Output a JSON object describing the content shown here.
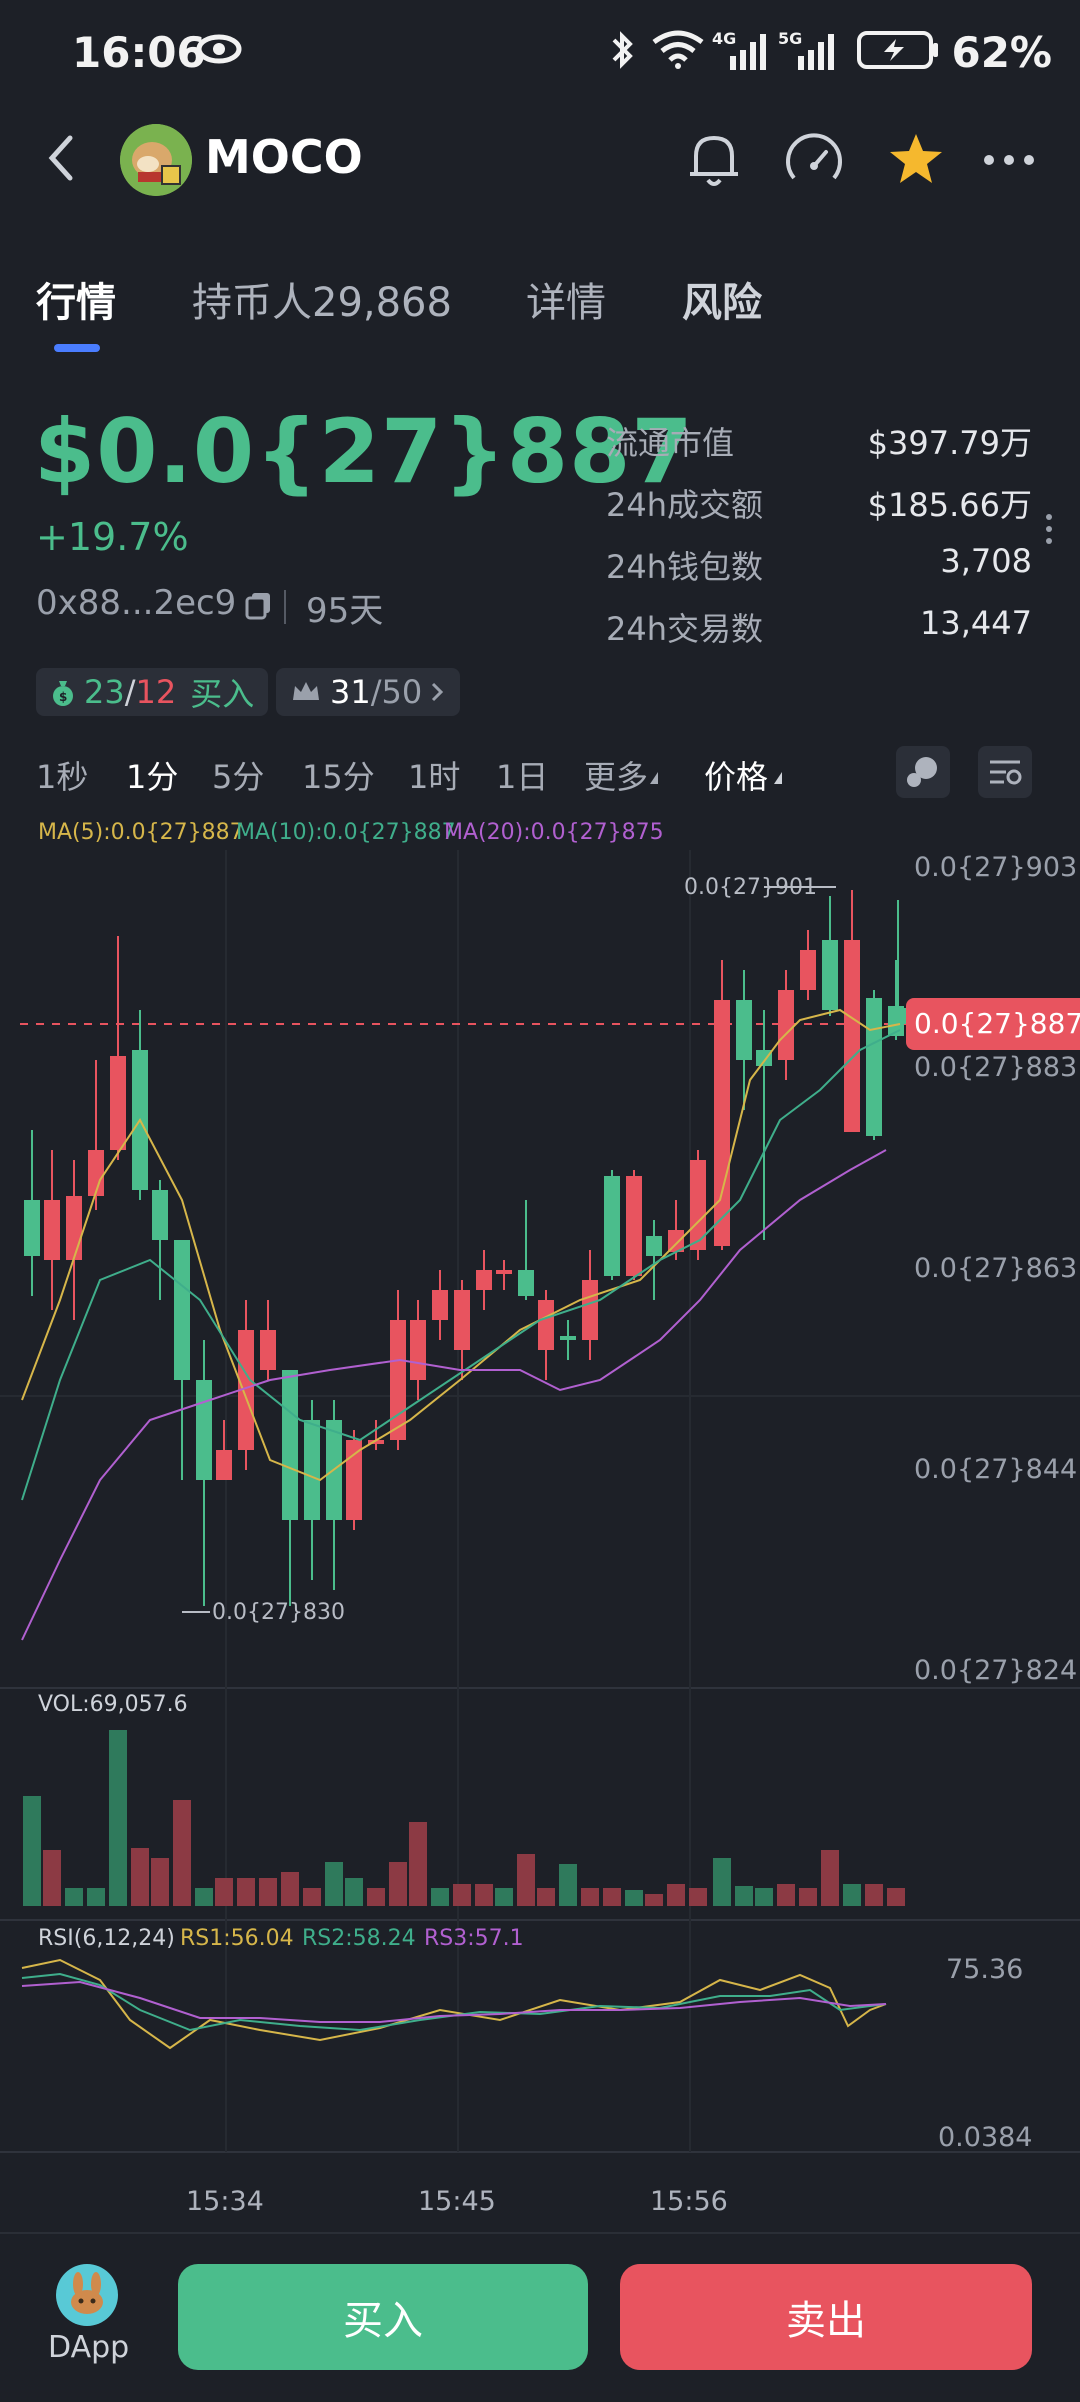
{
  "status": {
    "time": "16:06",
    "battery": "62%"
  },
  "header": {
    "title": "MOCO"
  },
  "tabs": [
    {
      "label": "行情"
    },
    {
      "label": "持币人29,868"
    },
    {
      "label": "详情"
    },
    {
      "label": "风险"
    }
  ],
  "price": {
    "value": "$0.0{27}887",
    "change": "+19.7%",
    "address": "0x88...2ec9",
    "age": "95天"
  },
  "stats": [
    {
      "label": "流通市值",
      "value": "$397.79万"
    },
    {
      "label": "24h成交额",
      "value": "$185.66万"
    },
    {
      "label": "24h钱包数",
      "value": "3,708"
    },
    {
      "label": "24h交易数",
      "value": "13,447"
    }
  ],
  "chips": {
    "buy_green": "23",
    "slash": "/",
    "buy_red": "12",
    "buy_label": "买入",
    "top_a": "31",
    "top_b": "/50"
  },
  "timeframes": [
    "1秒",
    "1分",
    "5分",
    "15分",
    "1时",
    "1日",
    "更多",
    "价格"
  ],
  "ma": {
    "ma5": "MA(5):0.0{27}887",
    "ma10": "MA(10):0.0{27}887",
    "ma20": "MA(20):0.0{27}875"
  },
  "colors": {
    "up": "#4bbd8c",
    "down": "#e8545f",
    "ma5": "#d6b64a",
    "ma10": "#3fae8b",
    "ma20": "#b160d0"
  },
  "chart_data": {
    "type": "candlestick",
    "y_axis_labels": [
      "0.0{27}903",
      "0.0{27}883",
      "0.0{27}863",
      "0.0{27}844",
      "0.0{27}824"
    ],
    "current_price_label": "0.0{27}887",
    "high_label": "0.0{27}901",
    "low_label": "0.0{27}830",
    "x_labels": [
      "15:34",
      "15:45",
      "15:56"
    ],
    "volume_label": "VOL:69,057.6",
    "rsi_label": "RSI(6,12,24)",
    "rsi1": "RS1:56.04",
    "rsi2": "RS2:58.24",
    "rsi3": "RS3:57.1",
    "rsi_max": "75.36",
    "rsi_min": "0.0384"
  },
  "bottom": {
    "dapp": "DApp",
    "buy": "买入",
    "sell": "卖出"
  }
}
